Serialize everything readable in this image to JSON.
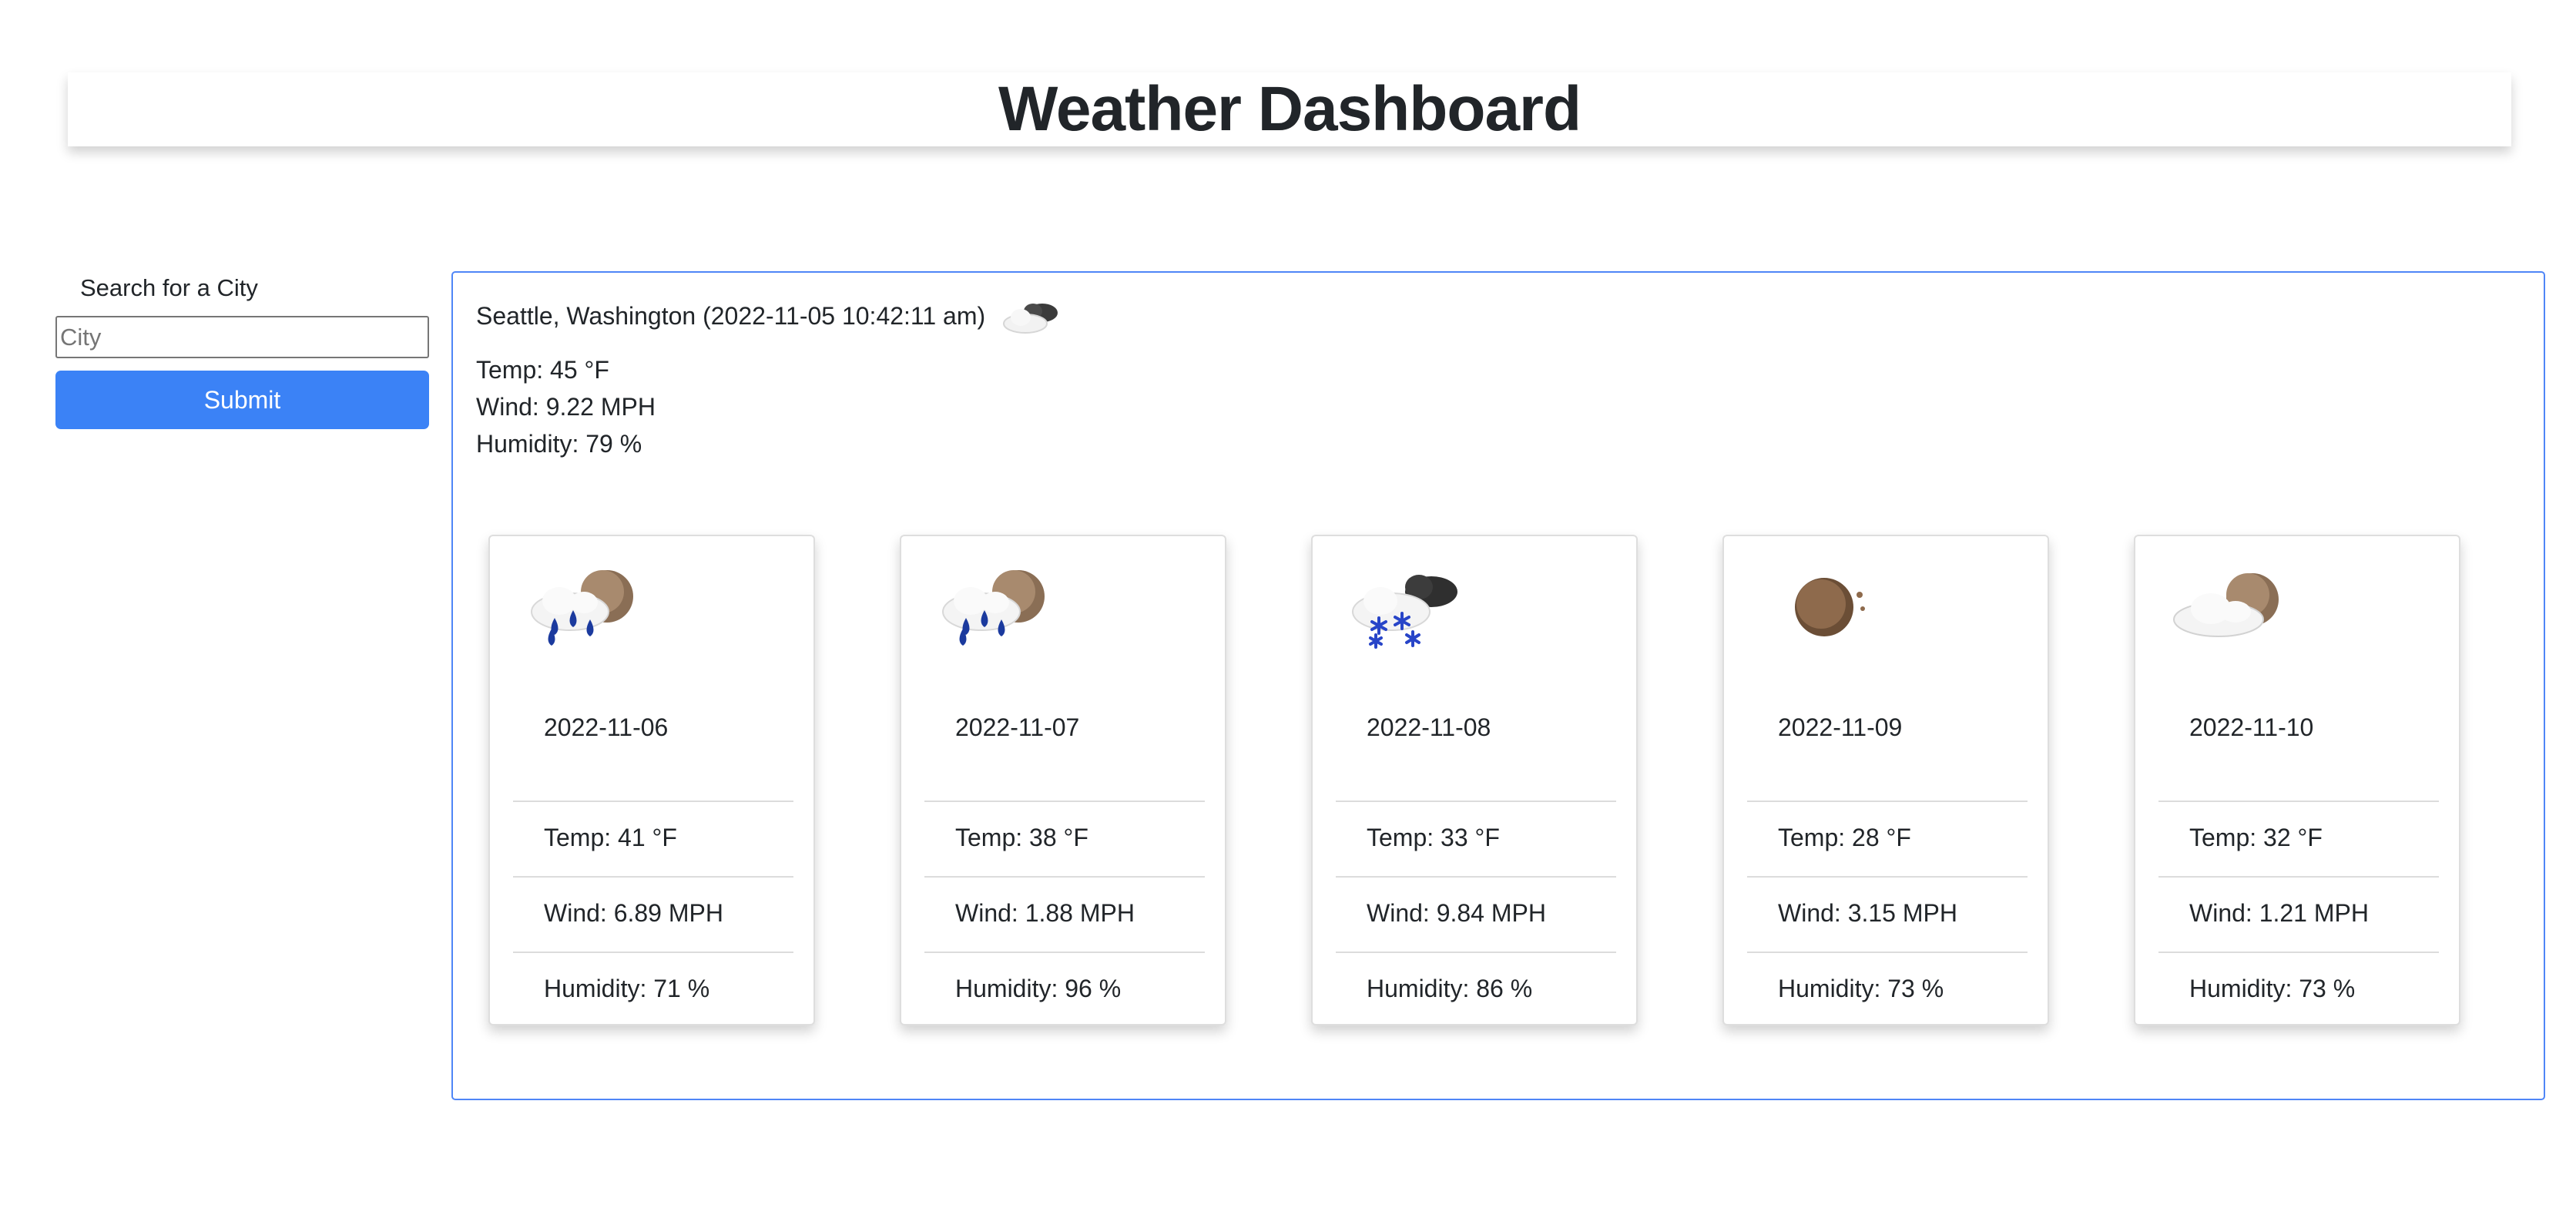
{
  "header": {
    "title": "Weather Dashboard"
  },
  "search": {
    "label": "Search for a City",
    "placeholder": "City",
    "value": "",
    "submit_label": "Submit"
  },
  "current": {
    "title": "Seattle, Washington (2022-11-05 10:42:11 am)",
    "icon": "partly-cloudy-night-icon",
    "temp": "Temp: 45 °F",
    "wind": "Wind: 9.22 MPH",
    "humidity": "Humidity: 79 %"
  },
  "forecast": [
    {
      "icon": "rain-night-icon",
      "date": "2022-11-06",
      "temp": "Temp: 41 °F",
      "wind": "Wind: 6.89 MPH",
      "humidity": "Humidity: 71 %"
    },
    {
      "icon": "rain-night-icon",
      "date": "2022-11-07",
      "temp": "Temp: 38 °F",
      "wind": "Wind: 1.88 MPH",
      "humidity": "Humidity: 96 %"
    },
    {
      "icon": "snow-icon",
      "date": "2022-11-08",
      "temp": "Temp: 33 °F",
      "wind": "Wind: 9.84 MPH",
      "humidity": "Humidity: 86 %"
    },
    {
      "icon": "clear-night-icon",
      "date": "2022-11-09",
      "temp": "Temp: 28 °F",
      "wind": "Wind: 3.15 MPH",
      "humidity": "Humidity: 73 %"
    },
    {
      "icon": "cloudy-night-icon",
      "date": "2022-11-10",
      "temp": "Temp: 32 °F",
      "wind": "Wind: 1.21 MPH",
      "humidity": "Humidity: 73 %"
    }
  ],
  "colors": {
    "accent": "#3b82f6",
    "panel_border": "#4f86f7",
    "text": "#212529"
  }
}
